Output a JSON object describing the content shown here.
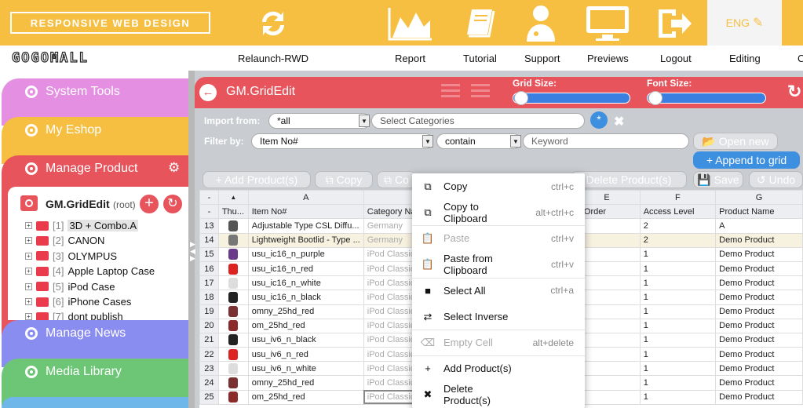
{
  "topbar": {
    "brand": "RESPONSIVE WEB DESIGN",
    "logo": "GOGOMALL",
    "language": "ENG",
    "nav": [
      {
        "label": "Relaunch-RWD",
        "icon": "refresh-icon"
      },
      {
        "label": "Report",
        "icon": "chart-icon"
      },
      {
        "label": "Tutorial",
        "icon": "book-icon"
      },
      {
        "label": "Support",
        "icon": "doctor-icon"
      },
      {
        "label": "Previews",
        "icon": "monitor-icon"
      },
      {
        "label": "Logout",
        "icon": "logout-icon"
      },
      {
        "label": "Editing",
        "icon": "edit-icon"
      },
      {
        "label": "C",
        "icon": ""
      }
    ]
  },
  "sidebar": {
    "sections": [
      {
        "label": "System Tools",
        "color": "#e48fe1"
      },
      {
        "label": "My Eshop",
        "color": "#f6bf42"
      },
      {
        "label": "Manage Product",
        "color": "#e7545c"
      },
      {
        "label": "Manage News",
        "color": "#8a8df0"
      },
      {
        "label": "Media Library",
        "color": "#6cc676"
      }
    ],
    "tree": {
      "root_label": "GM.GridEdit",
      "root_suffix": "(root)",
      "items": [
        {
          "index": "[1]",
          "label": "3D + Combo.A"
        },
        {
          "index": "[2]",
          "label": "CANON"
        },
        {
          "index": "[3]",
          "label": "OLYMPUS"
        },
        {
          "index": "[4]",
          "label": "Apple Laptop Case"
        },
        {
          "index": "[5]",
          "label": "iPod Case"
        },
        {
          "index": "[6]",
          "label": "iPhone Cases"
        },
        {
          "index": "[7]",
          "label": "dont publish"
        }
      ]
    }
  },
  "grid_editor": {
    "title": "GM.GridEdit",
    "grid_size_label": "Grid Size:",
    "font_size_label": "Font Size:",
    "import_label": "Import from:",
    "import_value": "*all",
    "category_placeholder": "Select Categories",
    "filter_label": "Filter by:",
    "filter_field": "Item No#",
    "filter_op": "contain",
    "keyword_placeholder": "Keyword",
    "open_new": "Open new",
    "append": "+ Append to grid",
    "toolbar": {
      "add": "+ Add Product(s)",
      "copy": "Copy",
      "copy2": "Co",
      "delete": "Delete Product(s)",
      "save": "Save",
      "undo": "Undo"
    },
    "col_letters": [
      "-",
      "",
      "A",
      "",
      "",
      "E",
      "F",
      "G"
    ],
    "columns": [
      "-",
      "Thu...",
      "Item No#",
      "Category Nam",
      "",
      "y Order",
      "Access Level",
      "Product Name"
    ],
    "rows": [
      {
        "n": "13",
        "thumb": "#555",
        "item": "Adjustable Type CSL Diffu...",
        "cat": "Germany",
        "order": "",
        "access": "2",
        "name": "A"
      },
      {
        "n": "14",
        "thumb": "#777",
        "item": "Lightweight Bootlid - Type ...",
        "cat": "Germany",
        "order": "",
        "access": "2",
        "name": "Demo Product"
      },
      {
        "n": "15",
        "thumb": "#6b3a8a",
        "item": "usu_ic16_n_purple",
        "cat": "iPod Classic",
        "order": "",
        "access": "1",
        "name": "Demo Product"
      },
      {
        "n": "16",
        "thumb": "#d22",
        "item": "usu_ic16_n_red",
        "cat": "iPod Classic",
        "order": "",
        "access": "1",
        "name": "Demo Product"
      },
      {
        "n": "17",
        "thumb": "#ddd",
        "item": "usu_ic16_n_white",
        "cat": "iPod Classic",
        "order": "",
        "access": "1",
        "name": "Demo Product"
      },
      {
        "n": "18",
        "thumb": "#222",
        "item": "usu_ic16_n_black",
        "cat": "iPod Classic",
        "order": "",
        "access": "1",
        "name": "Demo Product"
      },
      {
        "n": "19",
        "thumb": "#7a3030",
        "item": "omny_25hd_red",
        "cat": "iPod Classic",
        "order": "",
        "access": "1",
        "name": "Demo Product"
      },
      {
        "n": "20",
        "thumb": "#8a2a2a",
        "item": "om_25hd_red",
        "cat": "iPod Classic",
        "order": "",
        "access": "1",
        "name": "Demo Product"
      },
      {
        "n": "21",
        "thumb": "#222",
        "item": "usu_iv6_n_black",
        "cat": "iPod Classic",
        "order": "",
        "access": "1",
        "name": "Demo Product"
      },
      {
        "n": "22",
        "thumb": "#d22",
        "item": "usu_iv6_n_red",
        "cat": "iPod Classic",
        "order": "",
        "access": "1",
        "name": "Demo Product"
      },
      {
        "n": "23",
        "thumb": "#ddd",
        "item": "usu_iv6_n_white",
        "cat": "iPod Classic",
        "order": "",
        "access": "1",
        "name": "Demo Product"
      },
      {
        "n": "24",
        "thumb": "#7a3030",
        "item": "omny_25hd_red",
        "cat": "iPod Classic",
        "order": "",
        "access": "1",
        "name": "Demo Product"
      },
      {
        "n": "25",
        "thumb": "#8a2a2a",
        "item": "om_25hd_red",
        "cat": "iPod Classic",
        "order": "",
        "access": "1",
        "name": "Demo Product"
      }
    ]
  },
  "context_menu": [
    {
      "label": "Copy",
      "shortcut": "ctrl+c",
      "icon": "copy-icon",
      "disabled": false
    },
    {
      "label": "Copy to Clipboard",
      "shortcut": "alt+ctrl+c",
      "icon": "copy-icon",
      "disabled": false
    },
    {
      "label": "Paste",
      "shortcut": "ctrl+v",
      "icon": "paste-icon",
      "disabled": true
    },
    {
      "label": "Paste from Clipboard",
      "shortcut": "ctrl+v",
      "icon": "paste-icon",
      "disabled": false
    },
    {
      "label": "Select All",
      "shortcut": "ctrl+a",
      "icon": "select-all-icon",
      "disabled": false
    },
    {
      "label": "Select Inverse",
      "shortcut": "",
      "icon": "swap-icon",
      "disabled": false
    },
    {
      "label": "Empty Cell",
      "shortcut": "alt+delete",
      "icon": "eraser-icon",
      "disabled": true
    },
    {
      "label": "Add Product(s)",
      "shortcut": "",
      "icon": "plus-icon",
      "disabled": false
    },
    {
      "label": "Delete Product(s)",
      "shortcut": "",
      "icon": "x-icon",
      "disabled": false
    }
  ]
}
